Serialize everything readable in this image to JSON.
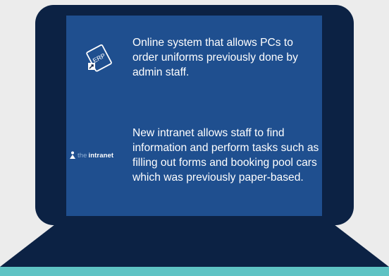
{
  "items": [
    {
      "icon": "erp-document-icon",
      "icon_label": "ERP",
      "text": "Online system that allows PCs to order uniforms previously done by admin staff."
    },
    {
      "icon": "theintranet-logo",
      "logo_prefix": "the",
      "logo_word": "intranet",
      "text": "New intranet allows staff to find information and perform tasks such as filling out forms and booking pool cars which was previously paper-based."
    }
  ],
  "colors": {
    "background": "#ececec",
    "laptop": "#0c2244",
    "screen": "#1f4f8f",
    "base_accent": "#5fc3c4"
  }
}
